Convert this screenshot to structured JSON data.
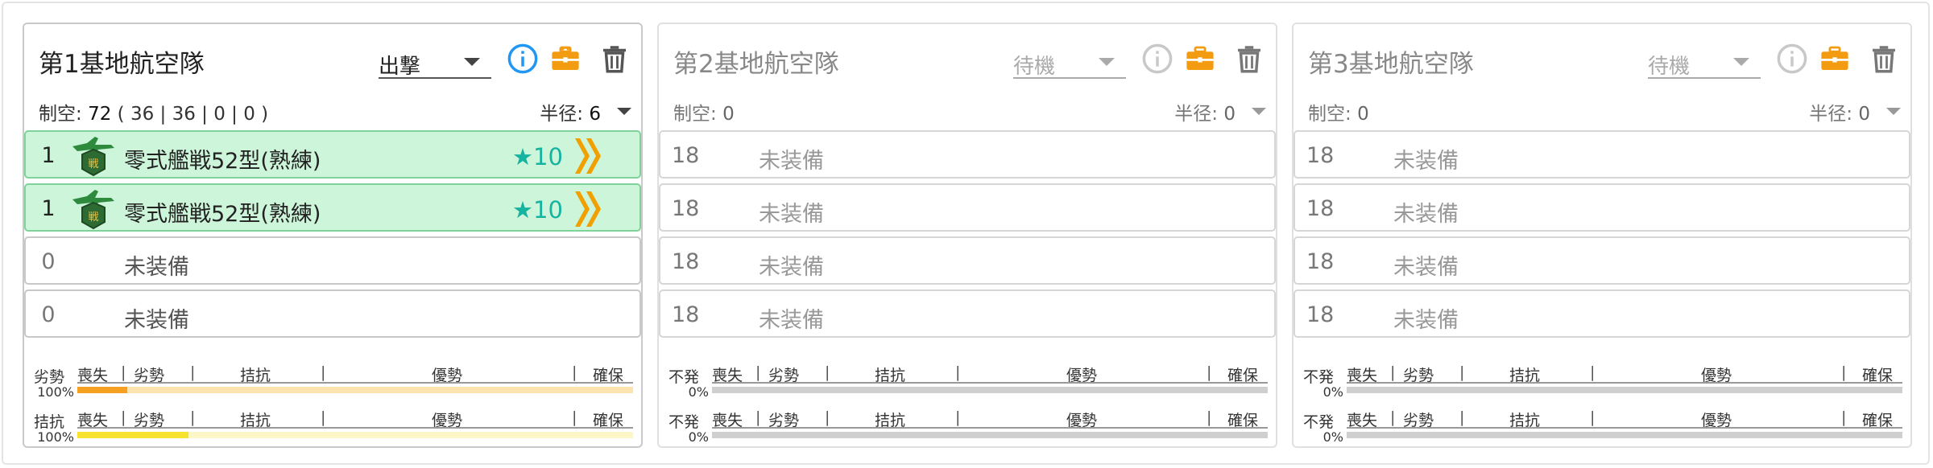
{
  "cards": [
    {
      "title": "第1基地航空隊",
      "mode": "出撃",
      "air_power_label": "制空: ",
      "air_power_value": "72",
      "air_power_detail": " ( 36 | 36 | 0 | 0 )",
      "radius_label": "半径: ",
      "radius_value": "6",
      "slots": [
        {
          "num": "1",
          "name": "零式艦戦52型(熟練)",
          "improvement": "★10",
          "equipped": true
        },
        {
          "num": "1",
          "name": "零式艦戦52型(熟練)",
          "improvement": "★10",
          "equipped": true
        },
        {
          "num": "0",
          "name": "未装備",
          "equipped": false
        },
        {
          "num": "0",
          "name": "未装備",
          "equipped": false
        }
      ],
      "bars": [
        {
          "status": "劣勢",
          "percent": "100%",
          "fill": 0.09,
          "fill_color": "#f5a020",
          "track_color": "#fde3b0"
        },
        {
          "status": "拮抗",
          "percent": "100%",
          "fill": 0.2,
          "fill_color": "#f7e230",
          "track_color": "#fdf7c8"
        }
      ]
    },
    {
      "title": "第2基地航空隊",
      "mode": "待機",
      "air_power_label": "制空: ",
      "air_power_value": "0",
      "air_power_detail": "",
      "radius_label": "半径: ",
      "radius_value": "0",
      "slots": [
        {
          "num": "18",
          "name": "未装備",
          "equipped": false
        },
        {
          "num": "18",
          "name": "未装備",
          "equipped": false
        },
        {
          "num": "18",
          "name": "未装備",
          "equipped": false
        },
        {
          "num": "18",
          "name": "未装備",
          "equipped": false
        }
      ],
      "bars": [
        {
          "status": "不発",
          "percent": "0%",
          "fill": 0,
          "fill_color": "#cfcfcf",
          "track_color": "#cfcfcf"
        },
        {
          "status": "不発",
          "percent": "0%",
          "fill": 0,
          "fill_color": "#cfcfcf",
          "track_color": "#cfcfcf"
        }
      ]
    },
    {
      "title": "第3基地航空隊",
      "mode": "待機",
      "air_power_label": "制空: ",
      "air_power_value": "0",
      "air_power_detail": "",
      "radius_label": "半径: ",
      "radius_value": "0",
      "slots": [
        {
          "num": "18",
          "name": "未装備",
          "equipped": false
        },
        {
          "num": "18",
          "name": "未装備",
          "equipped": false
        },
        {
          "num": "18",
          "name": "未装備",
          "equipped": false
        },
        {
          "num": "18",
          "name": "未装備",
          "equipped": false
        }
      ],
      "bars": [
        {
          "status": "不発",
          "percent": "0%",
          "fill": 0,
          "fill_color": "#cfcfcf",
          "track_color": "#cfcfcf"
        },
        {
          "status": "不発",
          "percent": "0%",
          "fill": 0,
          "fill_color": "#cfcfcf",
          "track_color": "#cfcfcf"
        }
      ]
    }
  ],
  "scale_labels": {
    "loss": "喪失",
    "inferior": "劣勢",
    "parity": "拮抗",
    "superiority": "優勢",
    "supremacy": "確保"
  },
  "icons": {
    "info": "info-icon",
    "equipment": "briefcase-icon",
    "delete": "trash-icon",
    "fighter": "fighter-plane-icon",
    "proficiency": "proficiency-chevron-icon"
  },
  "colors": {
    "info_active": "#2196f3",
    "briefcase": "#f39c12",
    "equipped_bg": "#cdf5da",
    "star": "#16b3a0",
    "proficiency": "#f0a000"
  }
}
